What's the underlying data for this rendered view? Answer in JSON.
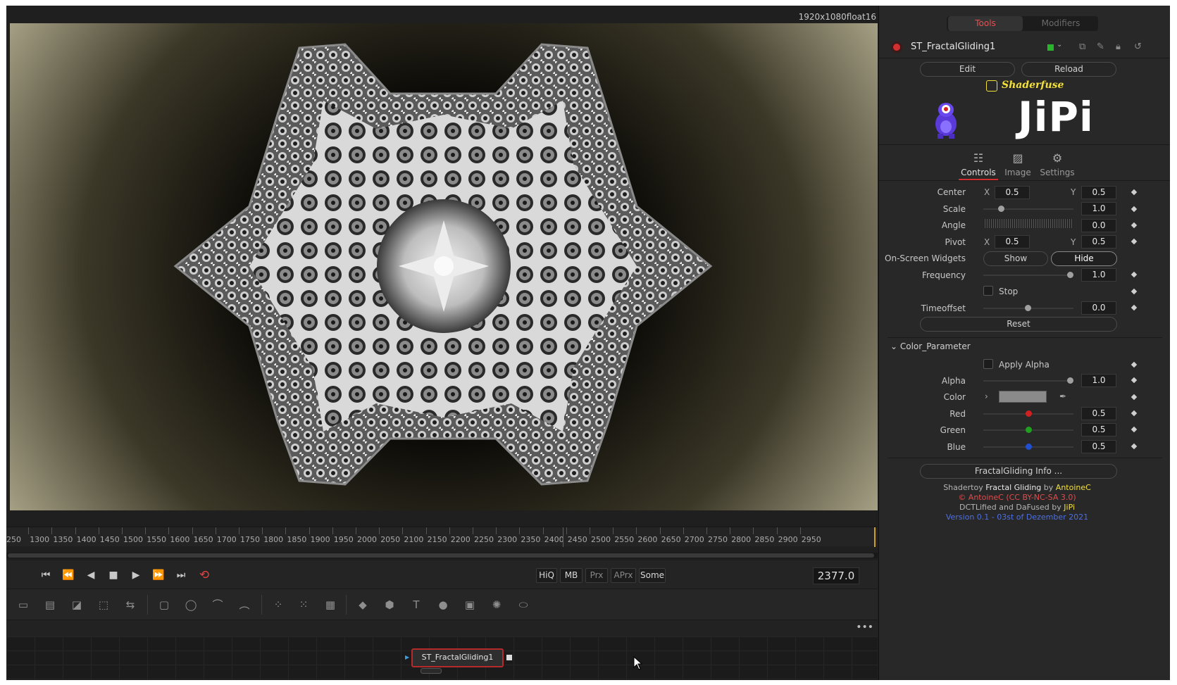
{
  "viewer": {
    "resolution": "1920x1080float16"
  },
  "timeline": {
    "ticks": [
      "250",
      "1300",
      "1350",
      "1400",
      "1450",
      "1500",
      "1550",
      "1600",
      "1650",
      "1700",
      "1750",
      "1800",
      "1850",
      "1900",
      "1950",
      "2000",
      "2050",
      "2100",
      "2150",
      "2200",
      "2250",
      "2300",
      "2350",
      "2400",
      "2450",
      "2500",
      "2550",
      "2600",
      "2650",
      "2700",
      "2750",
      "2800",
      "2850",
      "2900",
      "2950"
    ],
    "current_frame": "2377.0"
  },
  "transport": {
    "hiq": "HiQ",
    "mb": "MB",
    "prx": "Prx",
    "aprx": "APrx",
    "some": "Some",
    "goto_start": "⏮",
    "step_back": "⏪",
    "play_reverse": "◀",
    "stop": "■",
    "play": "▶",
    "step_forward": "⏩",
    "goto_end": "⏭",
    "loop": "⟲"
  },
  "toolbar": {
    "tools": [
      "background-icon",
      "fast-noise-icon",
      "text-icon",
      "merge-icon",
      "transform-icon",
      "rectangle-mask-icon",
      "ellipse-mask-icon",
      "polygon-mask-icon",
      "bspline-mask-icon",
      "particle-emitter-icon",
      "particle-render-icon",
      "particle-image-icon",
      "shape3d-icon",
      "merge3d-icon",
      "text3d-icon",
      "camera3d-icon",
      "image-plane-icon",
      "renderer3d-icon",
      "lights-icon"
    ],
    "glyphs": [
      "▭",
      "▤",
      "◪",
      "⬚",
      "⇆",
      "▢",
      "◯",
      "⌒",
      "︵",
      "⁘",
      "⁙",
      "▦",
      "◆",
      "⬢",
      "T",
      "●",
      "▣",
      "✺",
      "⬭"
    ]
  },
  "flow": {
    "more": "•••",
    "node_label": "ST_FractalGliding1"
  },
  "inspector": {
    "tabs": {
      "tools": "Tools",
      "modifiers": "Modifiers"
    },
    "tool_name": "ST_FractalGliding1",
    "edit_label": "Edit",
    "reload_label": "Reload",
    "shaderfuse": "Shaderfuse",
    "jipi_logo": "JiPi",
    "panel_tabs": {
      "controls": "Controls",
      "image": "Image",
      "settings": "Settings"
    },
    "params": {
      "center_label": "Center",
      "center_x": "0.5",
      "center_y": "0.5",
      "scale_label": "Scale",
      "scale": "1.0",
      "angle_label": "Angle",
      "angle": "0.0",
      "pivot_label": "Pivot",
      "pivot_x": "0.5",
      "pivot_y": "0.5",
      "osw_label": "On-Screen Widgets",
      "show": "Show",
      "hide": "Hide",
      "frequency_label": "Frequency",
      "frequency": "1.0",
      "stop_label": "Stop",
      "timeoffset_label": "Timeoffset",
      "timeoffset": "0.0",
      "reset": "Reset",
      "x": "X",
      "y": "Y"
    },
    "color_section": {
      "title": "Color_Parameter",
      "apply_alpha": "Apply Alpha",
      "alpha_label": "Alpha",
      "alpha": "1.0",
      "color_label": "Color",
      "swatch_color": "#8a8a8a",
      "red_label": "Red",
      "red": "0.5",
      "green_label": "Green",
      "green": "0.5",
      "blue_label": "Blue",
      "blue": "0.5"
    },
    "info_button": "FractalGliding Info ...",
    "credits": {
      "line1_a": "Shadertoy ",
      "line1_b": "Fractal Gliding",
      "line1_c": " by ",
      "line1_d": "AntoineC",
      "line2": "© AntoineC (CC BY-NC-SA 3.0)",
      "line3_a": "DCTLified and DaFused by ",
      "line3_b": "JiPi",
      "line4": "Version 0.1 - 03st of Dezember 2021"
    }
  },
  "colors": {
    "accent_red": "#d23030",
    "shaderfuse_yellow": "#f3e03b",
    "credit_red": "#e34a4a",
    "version_blue": "#4d6fe0"
  }
}
